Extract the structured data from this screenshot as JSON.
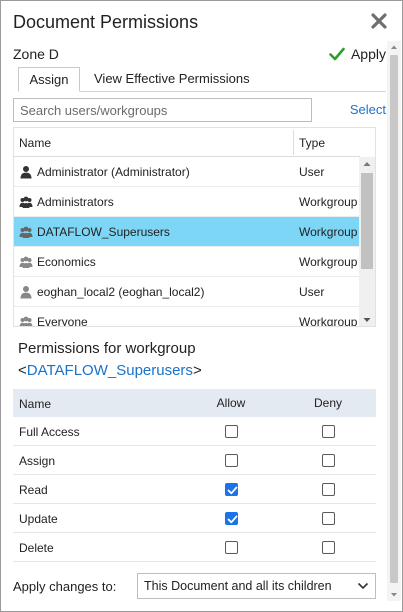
{
  "dialog": {
    "title": "Document Permissions",
    "zone": "Zone D",
    "apply_label": "Apply"
  },
  "tabs": [
    {
      "label": "Assign",
      "active": true
    },
    {
      "label": "View Effective Permissions",
      "active": false
    }
  ],
  "search": {
    "placeholder": "Search users/workgroups",
    "value": "",
    "select_label": "Select"
  },
  "principals": {
    "columns": {
      "name": "Name",
      "type": "Type"
    },
    "rows": [
      {
        "name": "Administrator (Administrator)",
        "type": "User",
        "icon": "user-icon",
        "selected": false
      },
      {
        "name": "Administrators",
        "type": "Workgroup",
        "icon": "workgroup-icon",
        "selected": false
      },
      {
        "name": "DATAFLOW_Superusers",
        "type": "Workgroup",
        "icon": "workgroup-icon",
        "selected": true
      },
      {
        "name": "Economics",
        "type": "Workgroup",
        "icon": "workgroup-icon",
        "selected": false
      },
      {
        "name": "eoghan_local2 (eoghan_local2)",
        "type": "User",
        "icon": "user-icon",
        "selected": false
      },
      {
        "name": "Everyone",
        "type": "Workgroup",
        "icon": "workgroup-icon",
        "selected": false
      }
    ]
  },
  "permissions": {
    "heading": "Permissions for workgroup",
    "target_open": "<",
    "target": "DATAFLOW_Superusers",
    "target_close": ">",
    "columns": {
      "name": "Name",
      "allow": "Allow",
      "deny": "Deny"
    },
    "rows": [
      {
        "name": "Full Access",
        "allow": false,
        "deny": false
      },
      {
        "name": "Assign",
        "allow": false,
        "deny": false
      },
      {
        "name": "Read",
        "allow": true,
        "deny": false
      },
      {
        "name": "Update",
        "allow": true,
        "deny": false
      },
      {
        "name": "Delete",
        "allow": false,
        "deny": false
      }
    ]
  },
  "apply_to": {
    "label": "Apply changes to:",
    "selected": "This Document and all its children"
  },
  "colors": {
    "selected_row": "#7dd6f5",
    "link": "#1a73c9",
    "checkbox_checked": "#1a73e8",
    "apply_check": "#2e9e2e",
    "header_bg": "#e4eaf1"
  }
}
